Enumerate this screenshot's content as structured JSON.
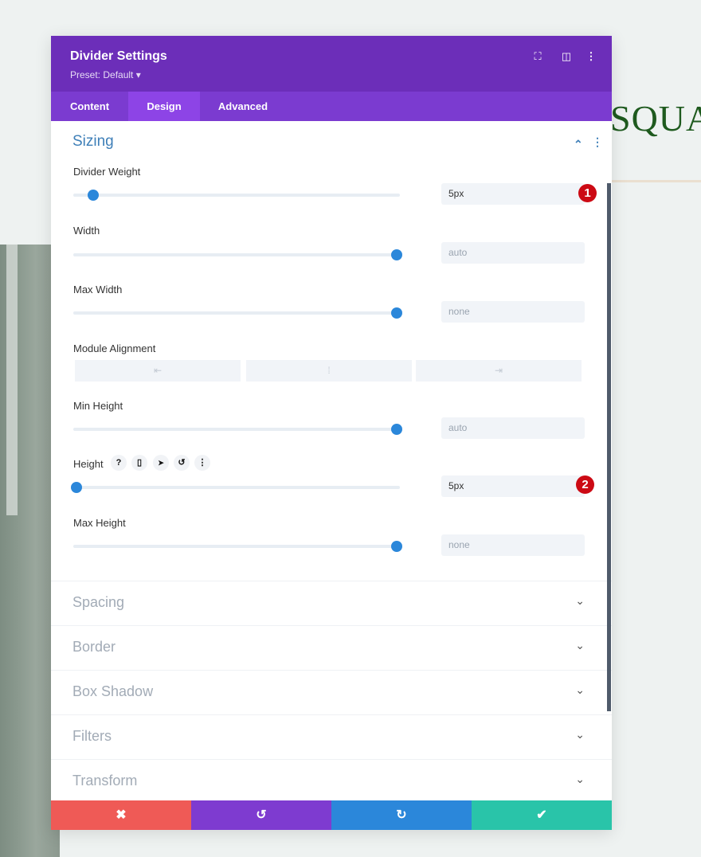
{
  "background": {
    "heading_fragment": "SQUA"
  },
  "panel": {
    "title": "Divider Settings",
    "preset": "Preset: Default ▾",
    "icons": [
      "fullscreen-icon",
      "split-view-icon",
      "more-icon"
    ]
  },
  "tabs": [
    {
      "label": "Content"
    },
    {
      "label": "Design",
      "active": true
    },
    {
      "label": "Advanced"
    }
  ],
  "section": {
    "title": "Sizing",
    "collapse_glyph": "⌃",
    "more_glyph": "⋮"
  },
  "fields": {
    "divider_weight": {
      "label": "Divider Weight",
      "value": "5px",
      "slider_percent": 6,
      "badge": "1"
    },
    "width": {
      "label": "Width",
      "placeholder": "auto",
      "slider_percent": 99
    },
    "max_width": {
      "label": "Max Width",
      "placeholder": "none",
      "slider_percent": 99
    },
    "module_alignment": {
      "label": "Module Alignment",
      "options": [
        "⇤",
        "⁞",
        "⇥"
      ]
    },
    "min_height": {
      "label": "Min Height",
      "placeholder": "auto",
      "slider_percent": 99
    },
    "height": {
      "label": "Height",
      "value": "5px",
      "slider_percent": 1,
      "badge": "2",
      "tools": [
        "?",
        "▯",
        "➤",
        "↺",
        "⋮"
      ]
    },
    "max_height": {
      "label": "Max Height",
      "placeholder": "none",
      "slider_percent": 99
    }
  },
  "collapsed_sections": [
    "Spacing",
    "Border",
    "Box Shadow",
    "Filters",
    "Transform"
  ],
  "footer": {
    "cancel": "✖",
    "undo": "↺",
    "redo": "↻",
    "save": "✔"
  },
  "colors": {
    "header": "#6c2eb9",
    "tabs": "#7b3bd0",
    "accent": "#2b87da",
    "cancel": "#ef5a56",
    "undo": "#7e3bd0",
    "redo": "#2b87da",
    "save": "#29c4a9"
  }
}
